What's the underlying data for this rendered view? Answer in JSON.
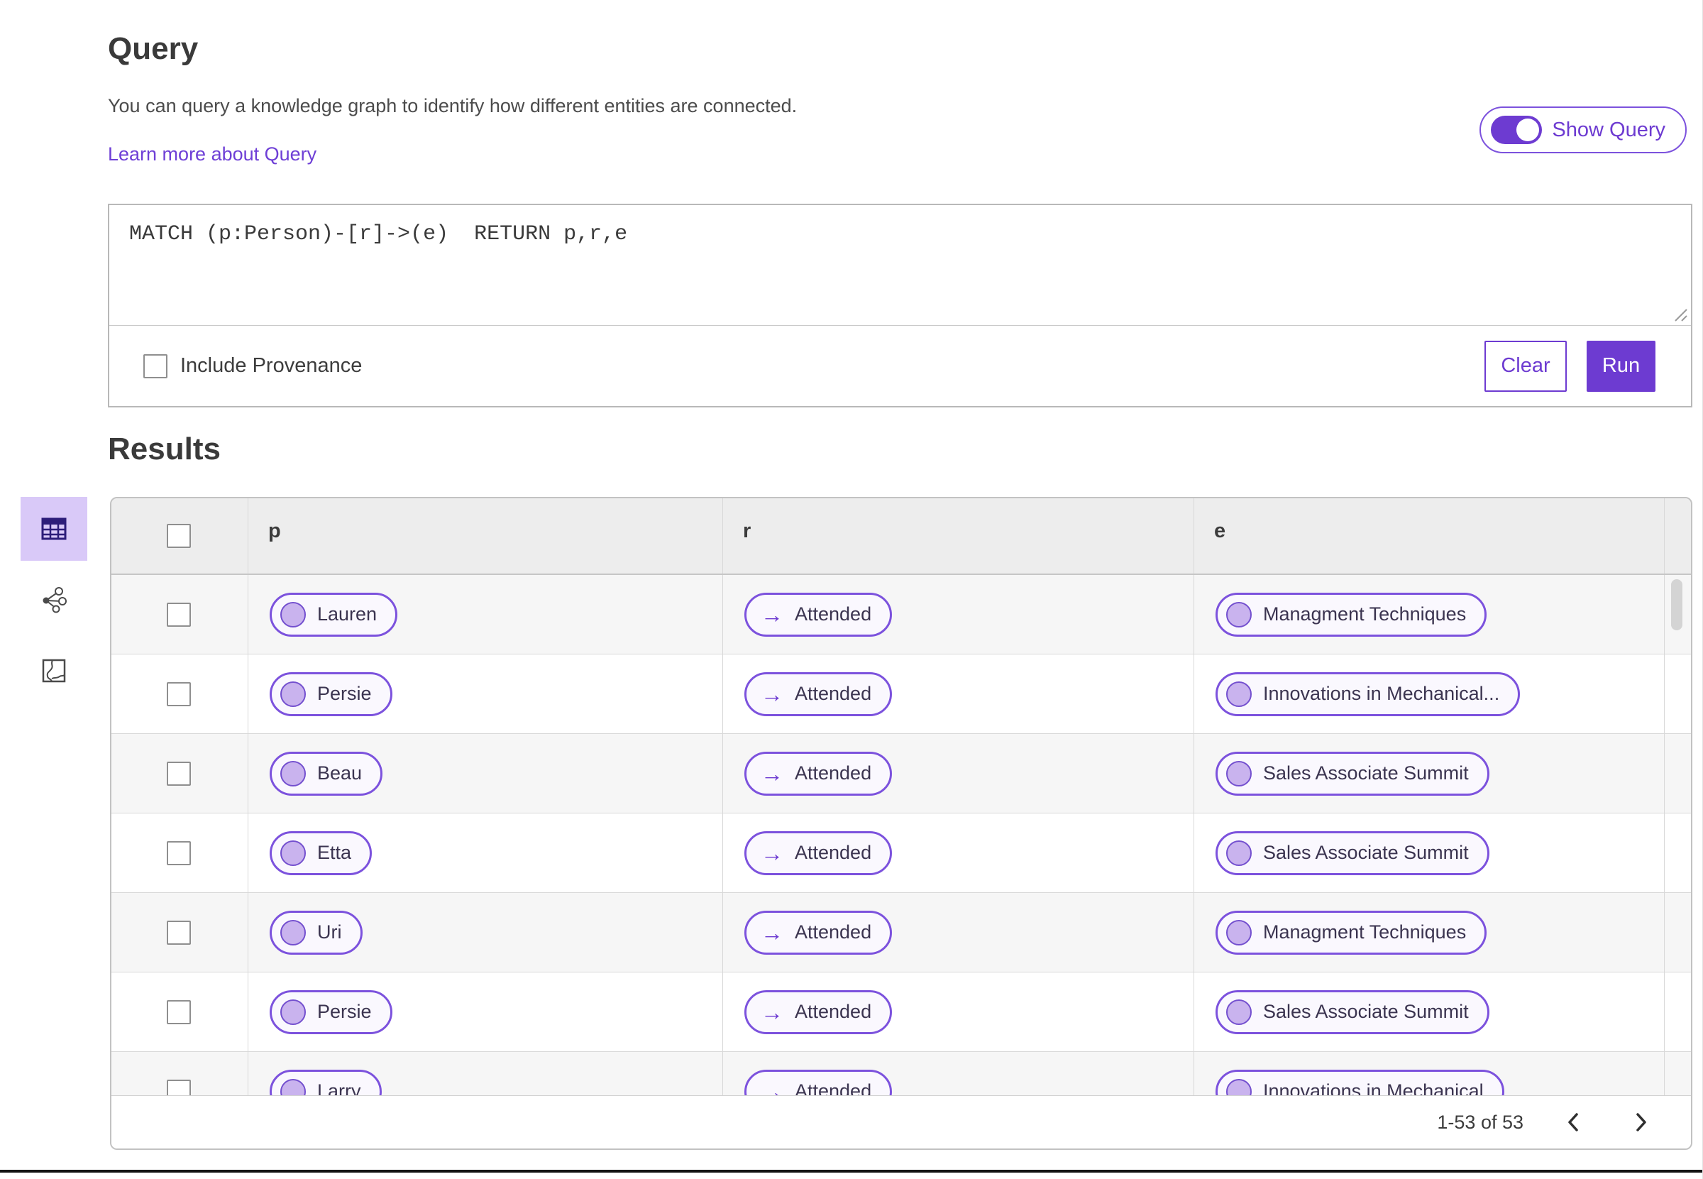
{
  "query_section": {
    "title": "Query",
    "description": "You can query a knowledge graph to identify how different entities are connected.",
    "learn_more_link": "Learn more about Query",
    "show_query_label": "Show Query",
    "show_query_on": true,
    "query_text": "MATCH (p:Person)-[r]->(e)  RETURN p,r,e",
    "include_provenance_label": "Include Provenance",
    "include_provenance_checked": false,
    "clear_button": "Clear",
    "run_button": "Run"
  },
  "results_section": {
    "title": "Results",
    "views": [
      {
        "name": "table-view",
        "selected": true
      },
      {
        "name": "graph-view",
        "selected": false
      },
      {
        "name": "map-view",
        "selected": false
      }
    ],
    "table": {
      "columns": [
        "p",
        "r",
        "e"
      ],
      "rows": [
        {
          "p": "Lauren",
          "r": "Attended",
          "e": "Managment Techniques"
        },
        {
          "p": "Persie",
          "r": "Attended",
          "e": "Innovations in Mechanical..."
        },
        {
          "p": "Beau",
          "r": "Attended",
          "e": "Sales Associate Summit"
        },
        {
          "p": "Etta",
          "r": "Attended",
          "e": "Sales Associate Summit"
        },
        {
          "p": "Uri",
          "r": "Attended",
          "e": "Managment Techniques"
        },
        {
          "p": "Persie",
          "r": "Attended",
          "e": "Sales Associate Summit"
        },
        {
          "p": "Larry",
          "r": "Attended",
          "e": "Innovations in Mechanical"
        }
      ]
    },
    "pagination": {
      "range_label": "1-53 of 53"
    }
  },
  "icons": {
    "arrow_right": "→"
  },
  "colors": {
    "accent_purple": "#6d3bd1",
    "pill_border": "#7c52dd",
    "pill_background": "#faf8fe",
    "node_fill": "#c9b3ee",
    "selected_view_background": "#d9c9f8",
    "table_header_background": "#ededed",
    "zebra_row_background": "#f6f6f6"
  }
}
